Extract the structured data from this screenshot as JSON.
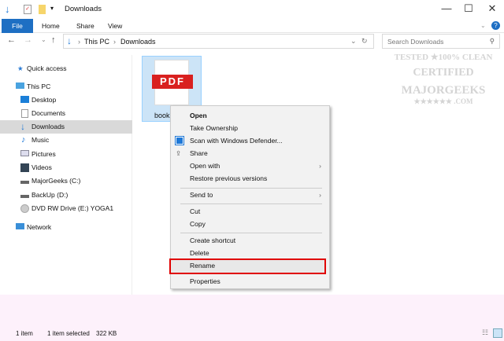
{
  "window": {
    "title": "Downloads",
    "minimize": "—",
    "maximize": "☐",
    "close": "✕"
  },
  "ribbon": {
    "tabs": [
      "File",
      "Home",
      "Share",
      "View"
    ]
  },
  "address": {
    "segments": [
      "This PC",
      "Downloads"
    ],
    "search_placeholder": "Search Downloads"
  },
  "sidebar": {
    "items": [
      {
        "label": "Quick access",
        "icon": "star-icon"
      },
      {
        "label": "This PC",
        "icon": "computer-icon"
      },
      {
        "label": "Desktop",
        "icon": "desktop-icon"
      },
      {
        "label": "Documents",
        "icon": "documents-icon"
      },
      {
        "label": "Downloads",
        "icon": "download-icon"
      },
      {
        "label": "Music",
        "icon": "music-icon"
      },
      {
        "label": "Pictures",
        "icon": "pictures-icon"
      },
      {
        "label": "Videos",
        "icon": "videos-icon"
      },
      {
        "label": "MajorGeeks (C:)",
        "icon": "drive-icon"
      },
      {
        "label": "BackUp (D:)",
        "icon": "drive-icon"
      },
      {
        "label": "DVD RW Drive (E:) YOGA1",
        "icon": "dvd-icon"
      },
      {
        "label": "Network",
        "icon": "network-icon"
      }
    ]
  },
  "file": {
    "name": "book",
    "badge": "PDF"
  },
  "context_menu": {
    "items": [
      "Open",
      "Take Ownership",
      "Scan with Windows Defender...",
      "Share",
      "Open with",
      "Restore previous versions",
      "Send to",
      "Cut",
      "Copy",
      "Create shortcut",
      "Delete",
      "Rename",
      "Properties"
    ]
  },
  "status": {
    "count": "1 item",
    "selected": "1 item selected",
    "size": "322 KB"
  },
  "watermark": {
    "line1": "TESTED ★100% CLEAN",
    "line2": "CERTIFIED",
    "line3": "MAJORGEEKS",
    "line4": "★★★★★★ .COM"
  },
  "colors": {
    "accent": "#1e6fc3",
    "highlight": "#e00000",
    "pdf": "#d9201f"
  }
}
